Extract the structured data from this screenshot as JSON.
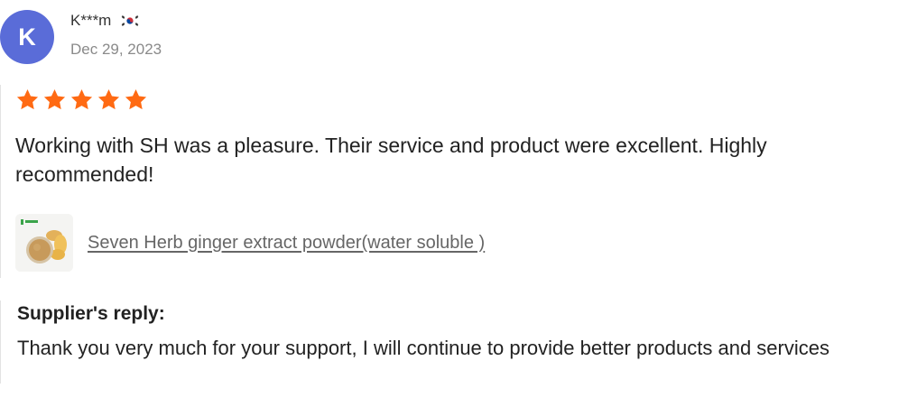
{
  "review": {
    "avatar_initial": "K",
    "reviewer_name": "K***m",
    "country_flag": "south-korea-flag-icon",
    "date": "Dec 29, 2023",
    "rating": 5,
    "rating_max": 5,
    "text": "Working with SH was a pleasure. Their service and product were excellent. Highly recommended!",
    "product": {
      "thumbnail_icon": "ginger-extract-thumbnail",
      "title": "Seven Herb ginger extract powder(water soluble )"
    },
    "supplier_reply": {
      "title": "Supplier's reply:",
      "text": "Thank you very much for your support, I will continue to provide better products and services"
    }
  },
  "colors": {
    "avatar": "#5a6cd8",
    "star": "#ff6a13",
    "link": "#666666",
    "divider": "#e3e3e3"
  }
}
